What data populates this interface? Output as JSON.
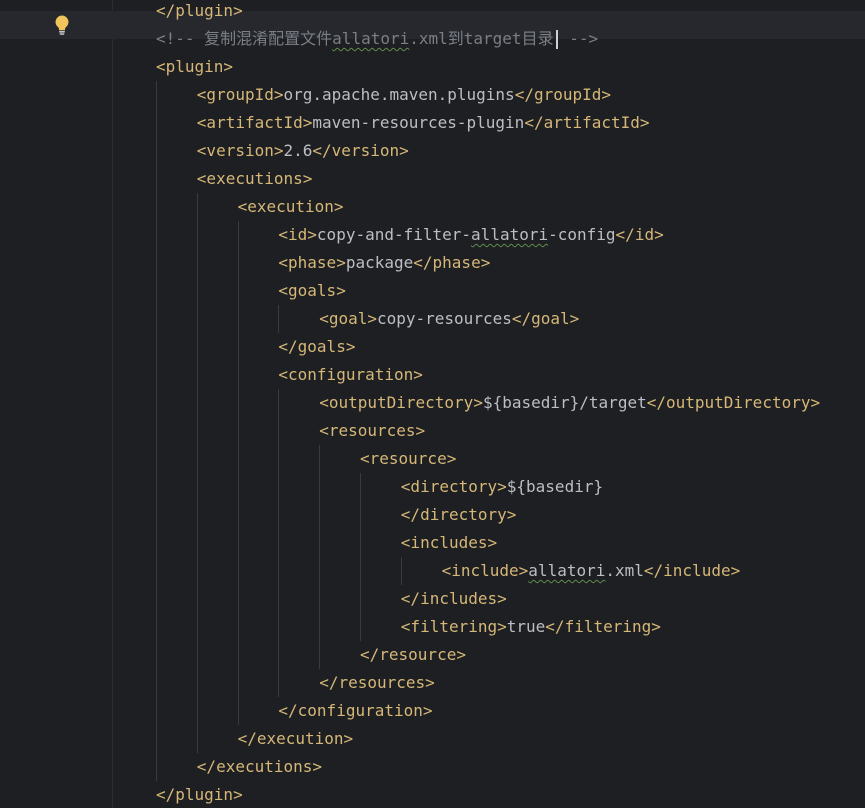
{
  "editor": {
    "gutter": {
      "intention_icon": "lightbulb-icon"
    },
    "lines": [
      {
        "indent": 0,
        "parts": [
          {
            "t": "</plugin>",
            "k": "tag"
          }
        ]
      },
      {
        "indent": 0,
        "current": true,
        "parts": [
          {
            "t": "<!-- 复制混淆配置文件",
            "k": "comment"
          },
          {
            "t": "allatori",
            "k": "comment",
            "typo": true
          },
          {
            "t": ".xml到target目录",
            "k": "comment"
          },
          {
            "caret": true
          },
          {
            "t": " -->",
            "k": "comment"
          }
        ]
      },
      {
        "indent": 0,
        "parts": [
          {
            "t": "<plugin>",
            "k": "tag"
          }
        ]
      },
      {
        "indent": 1,
        "parts": [
          {
            "t": "<groupId>",
            "k": "tag"
          },
          {
            "t": "org.apache.maven.plugins",
            "k": "text"
          },
          {
            "t": "</groupId>",
            "k": "tag"
          }
        ]
      },
      {
        "indent": 1,
        "parts": [
          {
            "t": "<artifactId>",
            "k": "tag"
          },
          {
            "t": "maven-resources-plugin",
            "k": "text"
          },
          {
            "t": "</artifactId>",
            "k": "tag"
          }
        ]
      },
      {
        "indent": 1,
        "parts": [
          {
            "t": "<version>",
            "k": "tag"
          },
          {
            "t": "2.6",
            "k": "text"
          },
          {
            "t": "</version>",
            "k": "tag"
          }
        ]
      },
      {
        "indent": 1,
        "parts": [
          {
            "t": "<executions>",
            "k": "tag"
          }
        ]
      },
      {
        "indent": 2,
        "parts": [
          {
            "t": "<execution>",
            "k": "tag"
          }
        ]
      },
      {
        "indent": 3,
        "parts": [
          {
            "t": "<id>",
            "k": "tag"
          },
          {
            "t": "copy-and-filter-",
            "k": "text"
          },
          {
            "t": "allatori",
            "k": "text",
            "typo": true
          },
          {
            "t": "-config",
            "k": "text"
          },
          {
            "t": "</id>",
            "k": "tag"
          }
        ]
      },
      {
        "indent": 3,
        "parts": [
          {
            "t": "<phase>",
            "k": "tag"
          },
          {
            "t": "package",
            "k": "text"
          },
          {
            "t": "</phase>",
            "k": "tag"
          }
        ]
      },
      {
        "indent": 3,
        "parts": [
          {
            "t": "<goals>",
            "k": "tag"
          }
        ]
      },
      {
        "indent": 4,
        "parts": [
          {
            "t": "<goal>",
            "k": "tag"
          },
          {
            "t": "copy-resources",
            "k": "text"
          },
          {
            "t": "</goal>",
            "k": "tag"
          }
        ]
      },
      {
        "indent": 3,
        "parts": [
          {
            "t": "</goals>",
            "k": "tag"
          }
        ]
      },
      {
        "indent": 3,
        "parts": [
          {
            "t": "<configuration>",
            "k": "tag"
          }
        ]
      },
      {
        "indent": 4,
        "parts": [
          {
            "t": "<outputDirectory>",
            "k": "tag"
          },
          {
            "t": "${basedir}/target",
            "k": "text"
          },
          {
            "t": "</outputDirectory>",
            "k": "tag"
          }
        ]
      },
      {
        "indent": 4,
        "parts": [
          {
            "t": "<resources>",
            "k": "tag"
          }
        ]
      },
      {
        "indent": 5,
        "parts": [
          {
            "t": "<resource>",
            "k": "tag"
          }
        ]
      },
      {
        "indent": 6,
        "parts": [
          {
            "t": "<directory>",
            "k": "tag"
          },
          {
            "t": "${basedir}",
            "k": "text"
          }
        ]
      },
      {
        "indent": 6,
        "parts": [
          {
            "t": "</directory>",
            "k": "tag"
          }
        ]
      },
      {
        "indent": 6,
        "parts": [
          {
            "t": "<includes>",
            "k": "tag"
          }
        ]
      },
      {
        "indent": 7,
        "parts": [
          {
            "t": "<include>",
            "k": "tag"
          },
          {
            "t": "allatori",
            "k": "text",
            "typo": true
          },
          {
            "t": ".xml",
            "k": "text"
          },
          {
            "t": "</include>",
            "k": "tag"
          }
        ]
      },
      {
        "indent": 6,
        "parts": [
          {
            "t": "</includes>",
            "k": "tag"
          }
        ]
      },
      {
        "indent": 6,
        "parts": [
          {
            "t": "<filtering>",
            "k": "tag"
          },
          {
            "t": "true",
            "k": "text"
          },
          {
            "t": "</filtering>",
            "k": "tag"
          }
        ]
      },
      {
        "indent": 5,
        "parts": [
          {
            "t": "</resource>",
            "k": "tag"
          }
        ]
      },
      {
        "indent": 4,
        "parts": [
          {
            "t": "</resources>",
            "k": "tag"
          }
        ]
      },
      {
        "indent": 3,
        "parts": [
          {
            "t": "</configuration>",
            "k": "tag"
          }
        ]
      },
      {
        "indent": 2,
        "parts": [
          {
            "t": "</execution>",
            "k": "tag"
          }
        ]
      },
      {
        "indent": 1,
        "parts": [
          {
            "t": "</executions>",
            "k": "tag"
          }
        ]
      },
      {
        "indent": 0,
        "parts": [
          {
            "t": "</plugin>",
            "k": "tag"
          }
        ]
      }
    ]
  }
}
